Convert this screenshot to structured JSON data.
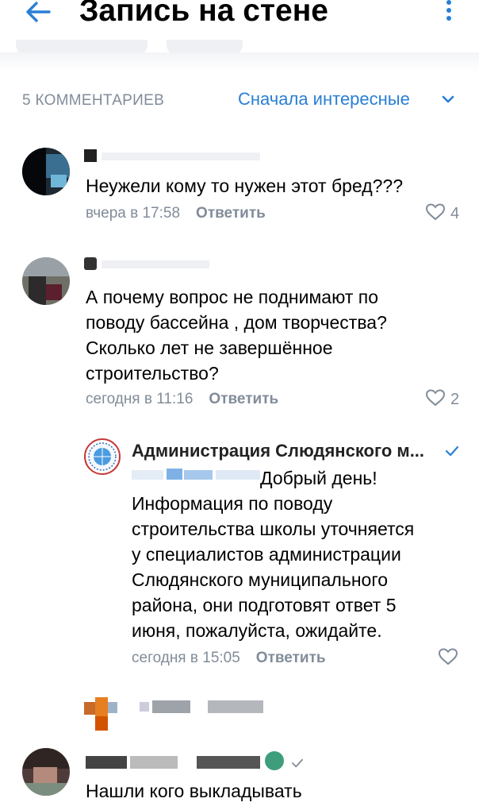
{
  "header": {
    "title": "Запись на стене"
  },
  "comments_bar": {
    "count_label": "5 КОММЕНТАРИЕВ",
    "sort_label": "Сначала интересные"
  },
  "comments": [
    {
      "text": "Неужели кому то нужен этот бред???",
      "time": "вчера в 17:58",
      "reply": "Ответить",
      "likes": "4"
    },
    {
      "text": "А почему вопрос не поднимают по\nповоду бассейна , дом творчества?\nСколько лет не завершённое\nстроительство?",
      "time": "сегодня в 11:16",
      "reply": "Ответить",
      "likes": "2"
    },
    {
      "author": "Администрация Слюдянского м...",
      "greeting": "Добрый день!",
      "text": "Информация по поводу\nстроительства школы уточняется\nу специалистов администрации\nСлюдянского муниципального\nрайона, они подготовят ответ 5\nиюня, пожалуйста, ожидайте.",
      "time": "сегодня в 15:05",
      "reply": "Ответить"
    },
    {
      "text": "Нашли кого выкладывать"
    }
  ],
  "colors": {
    "accent": "#2a7fd4",
    "secondary_text": "#818c99"
  }
}
